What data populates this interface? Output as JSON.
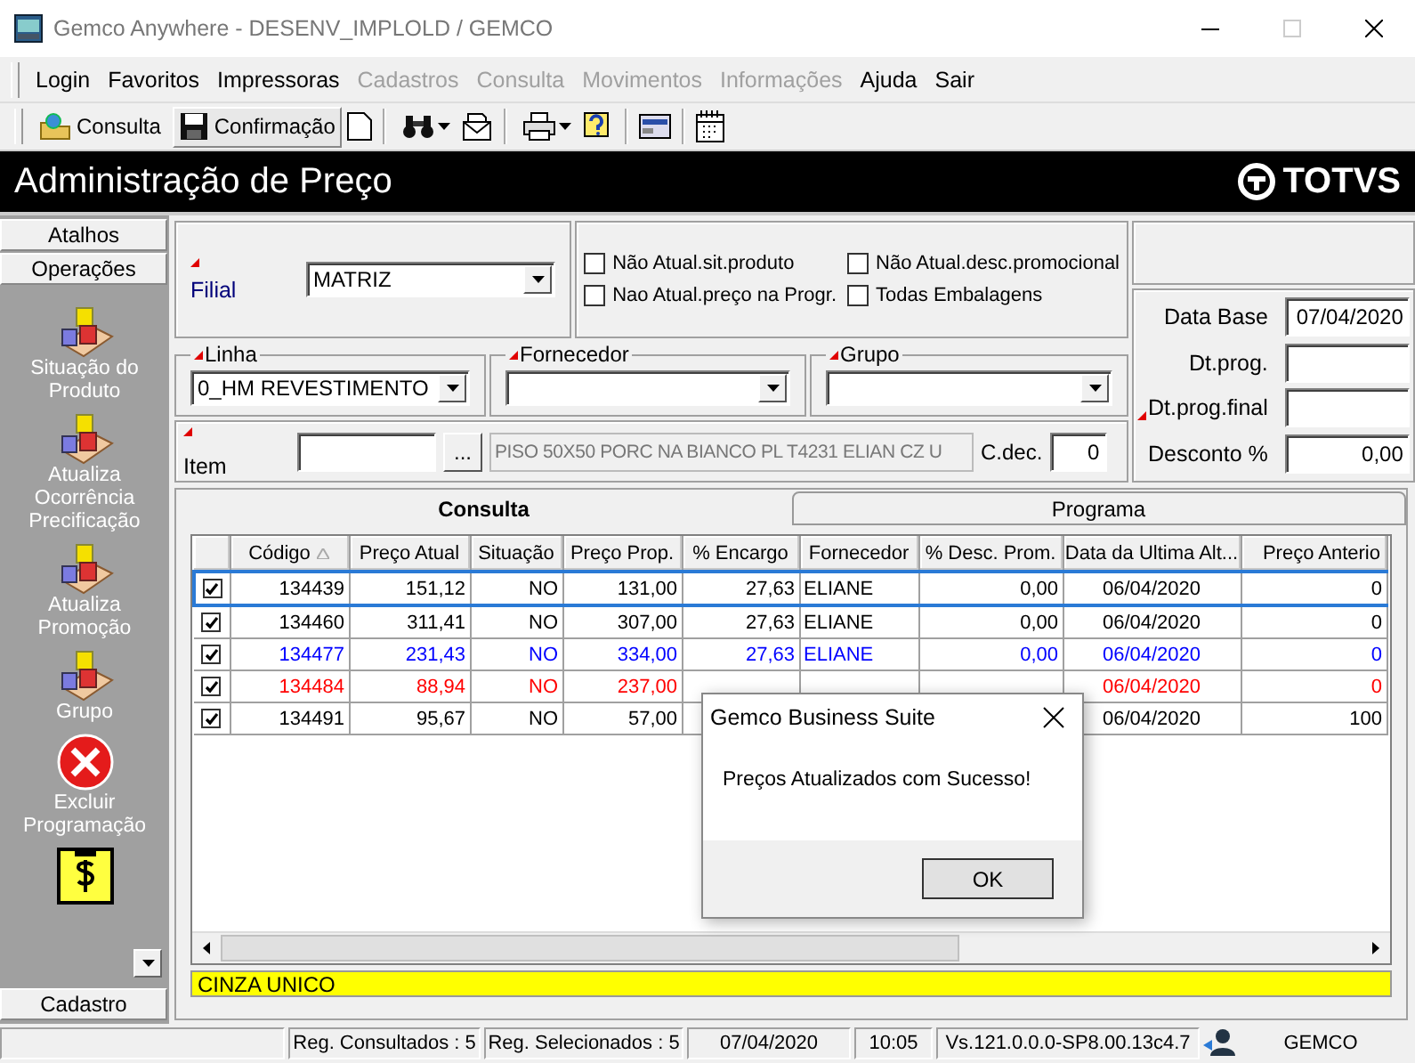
{
  "window": {
    "title": "Gemco Anywhere - DESENV_IMPLOLD / GEMCO"
  },
  "menu": [
    {
      "label": "Login",
      "disabled": false
    },
    {
      "label": "Favoritos",
      "disabled": false
    },
    {
      "label": "Impressoras",
      "disabled": false
    },
    {
      "label": "Cadastros",
      "disabled": true
    },
    {
      "label": "Consulta",
      "disabled": true
    },
    {
      "label": "Movimentos",
      "disabled": true
    },
    {
      "label": "Informações",
      "disabled": true
    },
    {
      "label": "Ajuda",
      "disabled": false
    },
    {
      "label": "Sair",
      "disabled": false
    }
  ],
  "toolbar": [
    {
      "label": "Consulta",
      "pressed": false
    },
    {
      "label": "Confirmação",
      "pressed": true
    }
  ],
  "header": {
    "title": "Administração de Preço",
    "logo": "TOTVS"
  },
  "sidebar": {
    "sections": [
      "Atalhos",
      "Operações"
    ],
    "items": [
      {
        "kind": "blocks",
        "label": "Situação do Produto"
      },
      {
        "kind": "blocks",
        "label": "Atualiza Ocorrência Precificação"
      },
      {
        "kind": "blocks",
        "label": "Atualiza Promoção"
      },
      {
        "kind": "blocks",
        "label": "Grupo"
      },
      {
        "kind": "delete",
        "label": "Excluir Programação"
      },
      {
        "kind": "money"
      }
    ],
    "footer": "Cadastro"
  },
  "filters": {
    "filial": {
      "label": "Filial",
      "value": "MATRIZ",
      "required": true
    },
    "options": [
      {
        "label": "Não Atual.sit.produto",
        "checked": false
      },
      {
        "label": "Não Atual.desc.promocional",
        "checked": false
      },
      {
        "label": "Nao Atual.preço na Progr.",
        "checked": false
      },
      {
        "label": "Todas Embalagens",
        "checked": false
      }
    ],
    "linha": {
      "label": "Linha",
      "value": "0_HM REVESTIMENTO",
      "required": true
    },
    "fornecedor": {
      "label": "Fornecedor",
      "required": true
    },
    "grupo": {
      "label": "Grupo",
      "required": true
    },
    "item": {
      "label": "Item",
      "required": true,
      "button": "...",
      "description": "PISO 50X50 PORC NA BIANCO PL T4231 ELIAN  CZ U"
    },
    "cdec": {
      "label": "C.dec.",
      "value": "0"
    },
    "dates": [
      {
        "label": "Data Base",
        "value": "07/04/2020",
        "required": false
      },
      {
        "label": "Dt.prog.",
        "required": false
      },
      {
        "label": "Dt.prog.final",
        "required": true
      },
      {
        "label": "Desconto %",
        "value": "0,00",
        "required": false
      }
    ]
  },
  "tabs": [
    {
      "label": "Consulta",
      "selected": true
    },
    {
      "label": "Programa",
      "selected": false
    }
  ],
  "table": {
    "columns": [
      {
        "label": "Código",
        "sorted": true
      },
      {
        "label": "Preço Atual",
        "sorted": false
      },
      {
        "label": "Situação",
        "sorted": false
      },
      {
        "label": "Preço Prop.",
        "sorted": false
      },
      {
        "label": "% Encargo",
        "sorted": false
      },
      {
        "label": "Fornecedor",
        "sorted": false
      },
      {
        "label": "% Desc. Prom.",
        "sorted": false
      },
      {
        "label": "Data da Ultima Alt...",
        "sorted": false
      },
      {
        "label": "Preço Anterio",
        "sorted": false
      }
    ],
    "rows": [
      {
        "checked": true,
        "selected": true,
        "color": "#000000",
        "cells": [
          "134439",
          "151,12",
          "NO",
          "131,00",
          "27,63",
          "ELIANE",
          "0,00",
          "06/04/2020",
          "0"
        ]
      },
      {
        "checked": true,
        "selected": false,
        "color": "#000000",
        "cells": [
          "134460",
          "311,41",
          "NO",
          "307,00",
          "27,63",
          "ELIANE",
          "0,00",
          "06/04/2020",
          "0"
        ]
      },
      {
        "checked": true,
        "selected": false,
        "color": "#0000ff",
        "cells": [
          "134477",
          "231,43",
          "NO",
          "334,00",
          "27,63",
          "ELIANE",
          "0,00",
          "06/04/2020",
          "0"
        ]
      },
      {
        "checked": true,
        "selected": false,
        "color": "#ff0000",
        "cells": [
          "134484",
          "88,94",
          "NO",
          "237,00",
          null,
          null,
          null,
          "06/04/2020",
          "0"
        ]
      },
      {
        "checked": true,
        "selected": false,
        "color": "#000000",
        "cells": [
          "134491",
          "95,67",
          "NO",
          "57,00",
          null,
          null,
          null,
          "06/04/2020",
          "100"
        ]
      }
    ]
  },
  "info_bar": "CINZA UNICO",
  "status_bar": [
    "Reg. Consultados : 5",
    "Reg. Selecionados : 5",
    "07/04/2020",
    "10:05",
    "Vs.121.0.0.0-SP8.00.13c4.7",
    "GEMCO"
  ],
  "dialog": {
    "title": "Gemco Business Suite",
    "message": "Preços Atualizados com Sucesso!",
    "button": "OK"
  }
}
